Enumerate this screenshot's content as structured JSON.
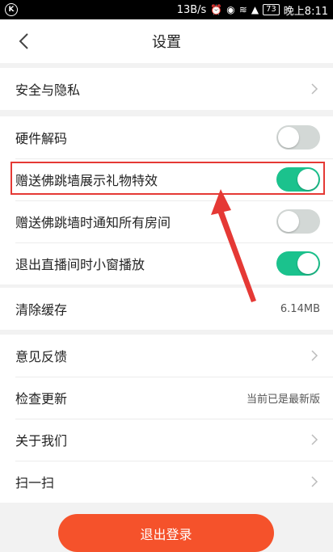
{
  "status_bar": {
    "left_logo": "K",
    "speed": "13B/s",
    "battery": "73",
    "time": "晚上8:11",
    "icons": [
      "alarm-icon",
      "eye-icon",
      "wifi-icon",
      "signal-icon",
      "battery-icon"
    ]
  },
  "nav": {
    "title": "设置",
    "back_icon": "chevron-left-icon"
  },
  "sections": {
    "security": {
      "label": "安全与隐私"
    },
    "toggles": [
      {
        "label": "硬件解码",
        "on": false
      },
      {
        "label": "赠送佛跳墙展示礼物特效",
        "on": true
      },
      {
        "label": "赠送佛跳墙时通知所有房间",
        "on": false
      },
      {
        "label": "退出直播间时小窗播放",
        "on": true
      }
    ],
    "cache": {
      "label": "清除缓存",
      "value": "6.14MB"
    },
    "misc": [
      {
        "label": "意见反馈",
        "value": ""
      },
      {
        "label": "检查更新",
        "value": "当前已是最新版"
      },
      {
        "label": "关于我们",
        "value": ""
      },
      {
        "label": "扫一扫",
        "value": ""
      }
    ]
  },
  "logout": {
    "label": "退出登录"
  },
  "colors": {
    "accent_green": "#1bc28d",
    "logout_orange": "#f5522b",
    "highlight_red": "#e53935"
  }
}
